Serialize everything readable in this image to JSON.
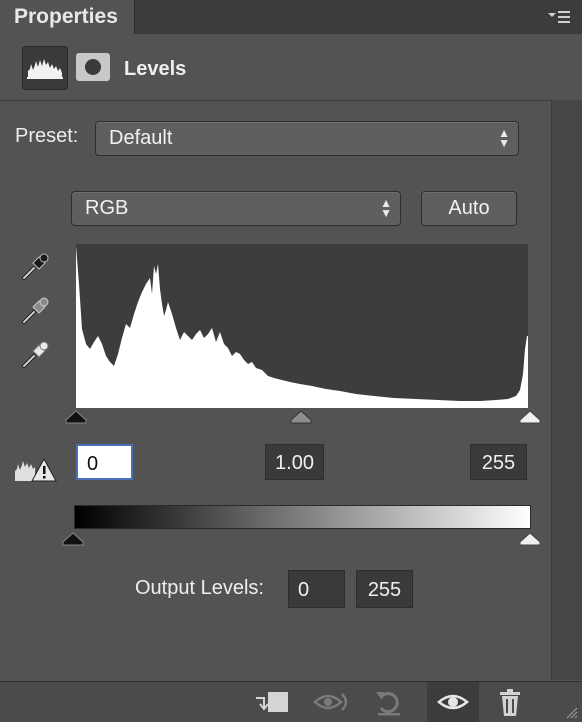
{
  "panel": {
    "tab_title": "Properties",
    "adjustment_title": "Levels"
  },
  "preset": {
    "label": "Preset:",
    "value": "Default"
  },
  "channel": {
    "value": "RGB"
  },
  "auto_button": {
    "label": "Auto"
  },
  "input_levels": {
    "black": "0",
    "gamma": "1.00",
    "white": "255"
  },
  "output_levels": {
    "label": "Output Levels:",
    "black": "0",
    "white": "255"
  },
  "colors": {
    "panel_bg": "#535353",
    "histogram_bg": "#3d3d3d",
    "histogram_fill": "#ffffff",
    "focus_border": "#4d6fb5"
  },
  "icons": [
    "panel-menu-icon",
    "levels-histogram-icon",
    "layer-mask-icon",
    "black-point-eyedropper-icon",
    "gray-point-eyedropper-icon",
    "white-point-eyedropper-icon",
    "clipping-warning-icon",
    "clip-to-layer-icon",
    "view-previous-state-icon",
    "reset-icon",
    "visibility-eye-icon",
    "delete-trash-icon"
  ]
}
